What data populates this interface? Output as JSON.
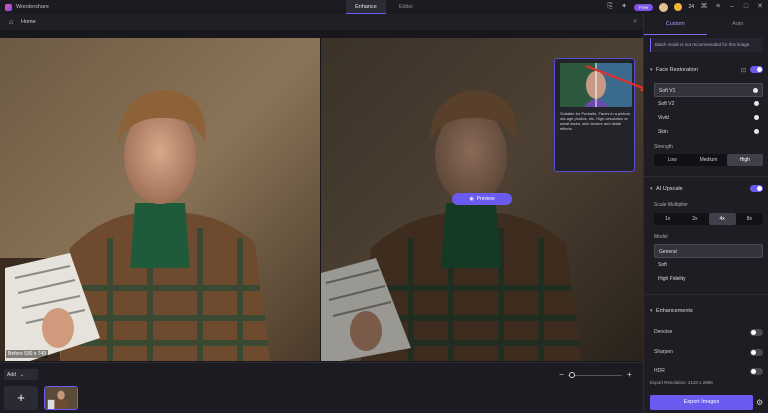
{
  "app": {
    "name": "Wondershare",
    "title_tabs": [
      {
        "label": "Enhance"
      },
      {
        "label": "Editor"
      }
    ]
  },
  "titlebar": {
    "badge": "Free",
    "credits": "24"
  },
  "subbar": {
    "breadcrumb": "Home"
  },
  "canvas": {
    "before_label": "Before 530 x 749",
    "preview_button": "Preview",
    "tooltip": {
      "text": "Suitable for Portraits, Faces in a picture, old-age photos, etc. High-resolution or small faces, skin texture and detail effects."
    }
  },
  "bottombar": {
    "add_label": "Add",
    "add_tile_symbol": "+",
    "zoom_minus": "−",
    "zoom_plus": "+"
  },
  "panel": {
    "tabs": [
      {
        "label": "Custom"
      },
      {
        "label": "Auto"
      }
    ],
    "notice": "Batch mode is not recommended for this image.",
    "face_restoration": {
      "title": "Face Restoration",
      "enabled": true,
      "options": [
        {
          "label": "Soft V1"
        },
        {
          "label": "Soft V2"
        },
        {
          "label": "Vivid"
        },
        {
          "label": "Skin"
        }
      ],
      "selected_index": 0,
      "strength_label": "Strength",
      "strength_options": [
        {
          "label": "Low"
        },
        {
          "label": "Medium"
        },
        {
          "label": "High"
        }
      ],
      "strength_selected": 2
    },
    "ai_upscale": {
      "title": "AI Upscale",
      "enabled": true,
      "scale_label": "Scale Multiplier",
      "scales": [
        {
          "label": "1x"
        },
        {
          "label": "2x"
        },
        {
          "label": "4x"
        },
        {
          "label": "8x"
        }
      ],
      "scale_selected": 2,
      "model_label": "Model",
      "models": [
        {
          "label": "General"
        },
        {
          "label": "Soft"
        },
        {
          "label": "High Fidelity"
        }
      ],
      "model_selected": 0
    },
    "enhancements": {
      "title": "Enhancements",
      "items": [
        {
          "label": "Denoise",
          "on": false
        },
        {
          "label": "Sharpen",
          "on": false
        },
        {
          "label": "HDR",
          "on": false
        }
      ]
    },
    "export_info": "Export Resolution: 2120 x 2996",
    "export_button": "Export Images"
  },
  "colors": {
    "accent": "#6a5af0",
    "arrow": "#e0302a"
  }
}
